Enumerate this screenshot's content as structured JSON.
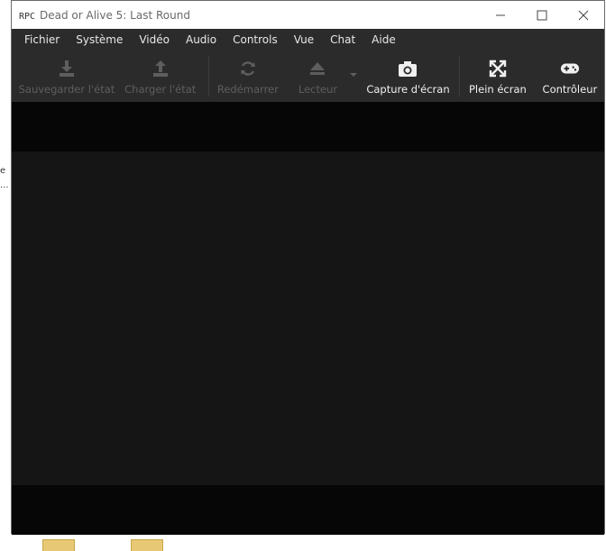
{
  "window": {
    "title": "Dead or Alive 5: Last Round"
  },
  "menu": [
    "Fichier",
    "Système",
    "Vidéo",
    "Audio",
    "Controls",
    "Vue",
    "Chat",
    "Aide"
  ],
  "toolbar": {
    "save_state": "Sauvegarder l'état",
    "load_state": "Charger l'état",
    "restart": "Redémarrer",
    "player": "Lecteur",
    "screenshot": "Capture d'écran",
    "fullscreen": "Plein écran",
    "controller": "Contrôleur"
  },
  "desktop": {
    "text_fragment_1": "e",
    "text_fragment_2": "..."
  },
  "colors": {
    "toolbar_bg": "#2b2b2b",
    "disabled_text": "#5e5e5e",
    "enabled_text": "#f0f0f0"
  }
}
